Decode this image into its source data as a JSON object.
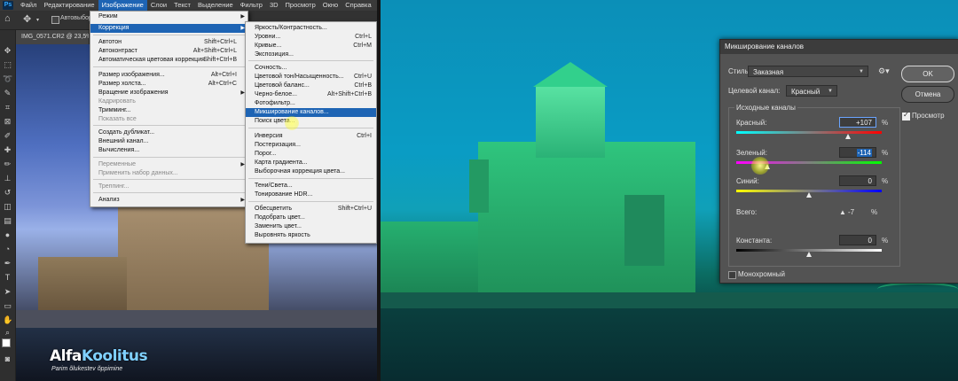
{
  "menubar": {
    "items": [
      "Файл",
      "Редактирование",
      "Изображение",
      "Слои",
      "Текст",
      "Выделение",
      "Фильтр",
      "3D",
      "Просмотр",
      "Окно",
      "Справка"
    ],
    "active_index": 2
  },
  "options_bar": {
    "autoselect": "Автовыбор"
  },
  "document_tab": "IMG_0571.CR2 @ 23,5%",
  "image_menu": {
    "items": [
      {
        "label": "Режим",
        "shortcut": "",
        "submenu": true
      },
      {
        "label": "Коррекция",
        "shortcut": "",
        "submenu": true,
        "highlighted": true
      },
      {
        "label": "Автотон",
        "shortcut": "Shift+Ctrl+L"
      },
      {
        "label": "Автоконтраст",
        "shortcut": "Alt+Shift+Ctrl+L"
      },
      {
        "label": "Автоматическая цветовая коррекция",
        "shortcut": "Shift+Ctrl+B"
      },
      {
        "label": "Размер изображения...",
        "shortcut": "Alt+Ctrl+I"
      },
      {
        "label": "Размер холста...",
        "shortcut": "Alt+Ctrl+C"
      },
      {
        "label": "Вращение изображения",
        "shortcut": "",
        "submenu": true
      },
      {
        "label": "Кадрировать",
        "shortcut": "",
        "disabled": true
      },
      {
        "label": "Тримминг...",
        "shortcut": ""
      },
      {
        "label": "Показать все",
        "shortcut": "",
        "disabled": true
      },
      {
        "label": "Создать дубликат...",
        "shortcut": ""
      },
      {
        "label": "Внешний канал...",
        "shortcut": ""
      },
      {
        "label": "Вычисления...",
        "shortcut": ""
      },
      {
        "label": "Переменные",
        "shortcut": "",
        "submenu": true,
        "disabled": true
      },
      {
        "label": "Применить набор данных...",
        "shortcut": "",
        "disabled": true
      },
      {
        "label": "Треппинг...",
        "shortcut": "",
        "disabled": true
      },
      {
        "label": "Анализ",
        "shortcut": "",
        "submenu": true
      }
    ]
  },
  "adjust_menu": {
    "items": [
      {
        "label": "Яркость/Контрастность...",
        "shortcut": ""
      },
      {
        "label": "Уровни...",
        "shortcut": "Ctrl+L"
      },
      {
        "label": "Кривые...",
        "shortcut": "Ctrl+M"
      },
      {
        "label": "Экспозиция...",
        "shortcut": ""
      },
      {
        "label": "Сочность...",
        "shortcut": ""
      },
      {
        "label": "Цветовой тон/Насыщенность...",
        "shortcut": "Ctrl+U"
      },
      {
        "label": "Цветовой баланс...",
        "shortcut": "Ctrl+B"
      },
      {
        "label": "Черно-белое...",
        "shortcut": "Alt+Shift+Ctrl+B"
      },
      {
        "label": "Фотофильтр...",
        "shortcut": ""
      },
      {
        "label": "Микширование каналов...",
        "shortcut": "",
        "highlighted": true
      },
      {
        "label": "Поиск цвета...",
        "shortcut": ""
      },
      {
        "label": "Инверсия",
        "shortcut": "Ctrl+I"
      },
      {
        "label": "Постеризация...",
        "shortcut": ""
      },
      {
        "label": "Порог...",
        "shortcut": ""
      },
      {
        "label": "Карта градиента...",
        "shortcut": ""
      },
      {
        "label": "Выборочная коррекция цвета...",
        "shortcut": ""
      },
      {
        "label": "Тени/Света...",
        "shortcut": ""
      },
      {
        "label": "Тонирование HDR...",
        "shortcut": ""
      },
      {
        "label": "Обесцветить",
        "shortcut": "Shift+Ctrl+U"
      },
      {
        "label": "Подобрать цвет...",
        "shortcut": ""
      },
      {
        "label": "Заменить цвет...",
        "shortcut": ""
      },
      {
        "label": "Выровнять яркость",
        "shortcut": ""
      }
    ]
  },
  "watermark": {
    "brand_a": "Alfa",
    "brand_b": "Koolitus",
    "tagline": "Parim õlukestev õppimine"
  },
  "dialog": {
    "title": "Микширование каналов",
    "preset_label": "Стиль:",
    "preset_value": "Заказная",
    "target_label": "Целевой канал:",
    "target_value": "Красный",
    "source_group": "Исходные каналы",
    "channels": [
      {
        "label": "Красный:",
        "value": "+107",
        "level": 107
      },
      {
        "label": "Зеленый:",
        "value": "-114",
        "level": -114
      },
      {
        "label": "Синий:",
        "value": "0",
        "level": 0
      }
    ],
    "total_label": "Всего:",
    "total_value": "-7",
    "percent": "%",
    "constant_label": "Константа:",
    "constant_value": "0",
    "constant_level": 0,
    "monochrome_label": "Монохромный",
    "ok_label": "OK",
    "cancel_label": "Отмена",
    "preview_label": "Просмотр",
    "preview_checked": true,
    "monochrome_checked": false
  }
}
